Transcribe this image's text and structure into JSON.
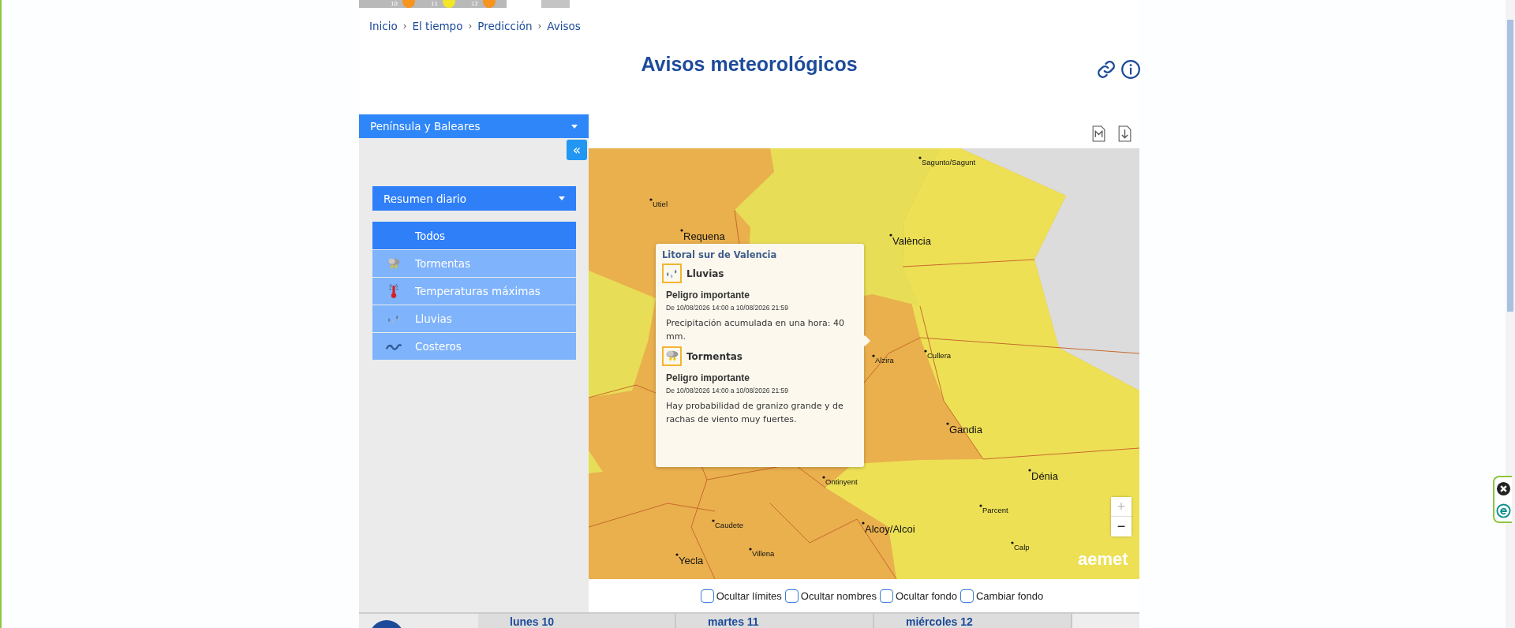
{
  "top_strip": {
    "days": [
      {
        "number": "10",
        "color": "#f7941d"
      },
      {
        "number": "11",
        "color": "#f2e627"
      },
      {
        "number": "12",
        "color": "#f7941d"
      }
    ]
  },
  "breadcrumb": {
    "separator": "›",
    "items": [
      "Inicio",
      "El tiempo",
      "Predicción",
      "Avisos"
    ]
  },
  "title": "Avisos meteorológicos",
  "sidebar": {
    "region_select": "Península y Baleares",
    "collapse_label": "«",
    "view_select": "Resumen diario",
    "filters": [
      {
        "label": "Todos",
        "kind": "all",
        "selected": true
      },
      {
        "label": "Tormentas",
        "kind": "storm",
        "selected": false
      },
      {
        "label": "Temperaturas máximas",
        "kind": "heat",
        "selected": false
      },
      {
        "label": "Lluvias",
        "kind": "rain",
        "selected": false
      },
      {
        "label": "Costeros",
        "kind": "coastal",
        "selected": false
      }
    ]
  },
  "map": {
    "cities": [
      "Sagunto/Sagunt",
      "Utiel",
      "Requena",
      "València",
      "Alzira",
      "Cullera",
      "Gandia",
      "Ontinyent",
      "Dénia",
      "Parcent",
      "Caudete",
      "Alcoy/Alcoi",
      "Calp",
      "Villena",
      "Yecla"
    ],
    "zoom_controls": [
      "+",
      "−"
    ],
    "logo": "aemet",
    "popup": {
      "zone": "Litoral sur de Valencia",
      "warnings": [
        {
          "kind": "rain",
          "title": "Lluvias",
          "level": "Peligro importante",
          "period": "De 10/08/2026 14:00 a 10/08/2026 21:59",
          "description": "Precipitación acumulada en una hora: 40 mm."
        },
        {
          "kind": "storm",
          "title": "Tormentas",
          "level": "Peligro importante",
          "period": "De 10/08/2026 14:00 a 10/08/2026 21:59",
          "description": "Hay probabilidad de granizo grande y de rachas de viento muy fuertes."
        }
      ]
    }
  },
  "map_options": [
    {
      "label": "Ocultar límites",
      "checked": false
    },
    {
      "label": "Ocultar nombres",
      "checked": false
    },
    {
      "label": "Ocultar fondo",
      "checked": false
    },
    {
      "label": "Cambiar fondo",
      "checked": false
    }
  ],
  "days": [
    "lunes 10",
    "martes 11",
    "miércoles 12"
  ]
}
